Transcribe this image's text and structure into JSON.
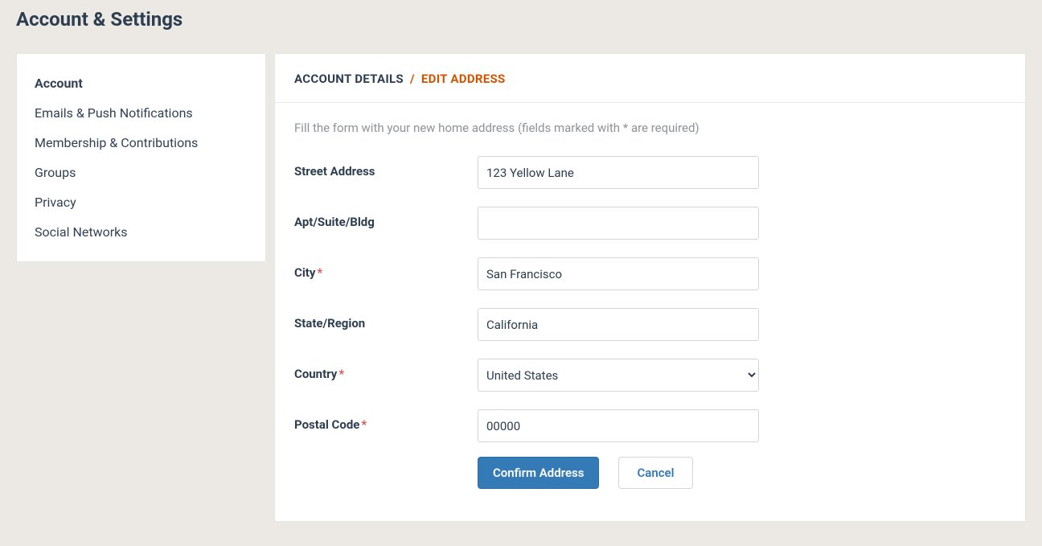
{
  "page": {
    "title": "Account & Settings"
  },
  "sidebar": {
    "items": [
      {
        "label": "Account",
        "active": true
      },
      {
        "label": "Emails & Push Notifications",
        "active": false
      },
      {
        "label": "Membership & Contributions",
        "active": false
      },
      {
        "label": "Groups",
        "active": false
      },
      {
        "label": "Privacy",
        "active": false
      },
      {
        "label": "Social Networks",
        "active": false
      }
    ]
  },
  "breadcrumb": {
    "parent": "Account Details",
    "separator": "/",
    "current": "Edit Address"
  },
  "form": {
    "help_text": "Fill the form with your new home address (fields marked with * are required)",
    "fields": {
      "street": {
        "label": "Street Address",
        "value": "123 Yellow Lane",
        "required": false
      },
      "apt": {
        "label": "Apt/Suite/Bldg",
        "value": "",
        "required": false
      },
      "city": {
        "label": "City",
        "value": "San Francisco",
        "required": true
      },
      "state": {
        "label": "State/Region",
        "value": "California",
        "required": false
      },
      "country": {
        "label": "Country",
        "value": "United States",
        "required": true
      },
      "postal": {
        "label": "Postal Code",
        "value": "00000",
        "required": true
      }
    },
    "required_marker": "*",
    "buttons": {
      "confirm": "Confirm Address",
      "cancel": "Cancel"
    }
  }
}
